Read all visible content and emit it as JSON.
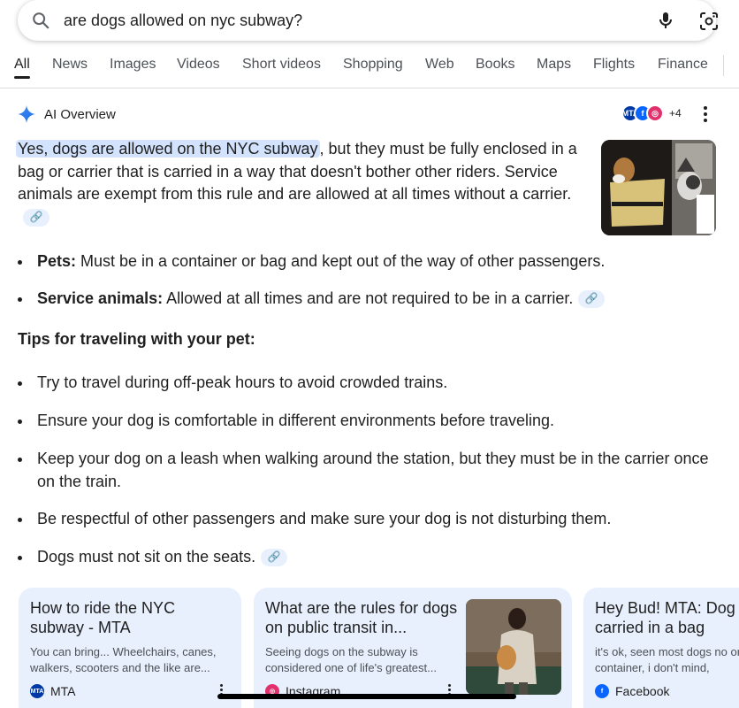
{
  "search": {
    "query": "are dogs allowed on nyc subway?"
  },
  "tabs": [
    "All",
    "News",
    "Images",
    "Videos",
    "Short videos",
    "Shopping",
    "Web",
    "Books",
    "Maps",
    "Flights",
    "Finance"
  ],
  "ai_overview": {
    "title": "AI Overview",
    "sources_more": "+4",
    "answer_highlight": "Yes, dogs are allowed on the NYC subway",
    "answer_rest": ", but they must be fully enclosed in a bag or carrier that is carried in a way that doesn't bother other riders. Service animals are exempt from this rule and are allowed at all times without a carrier.",
    "bullets": [
      {
        "label": "Pets:",
        "text": " Must be in a container or bag and kept out of the way of other passengers."
      },
      {
        "label": "Service animals:",
        "text": " Allowed at all times and are not required to be in a carrier."
      }
    ],
    "tips_title": "Tips for traveling with your pet:",
    "tips": [
      "Try to travel during off-peak hours to avoid crowded trains.",
      "Ensure your dog is comfortable in different environments before traveling.",
      "Keep your dog on a leash when walking around the station, but they must be in the carrier once on the train.",
      "Be respectful of other passengers and make sure your dog is not disturbing them.",
      "Dogs must not sit on the seats."
    ]
  },
  "cards": [
    {
      "title": "How to ride the NYC subway - MTA",
      "snippet": "You can bring... Wheelchairs, canes, walkers, scooters and the like are...",
      "source": "MTA"
    },
    {
      "title": "What are the rules for dogs on public transit in...",
      "snippet": "Seeing dogs on the subway is considered one of life's greatest...",
      "source": "Instagram"
    },
    {
      "title": "Hey Bud! MTA: Dog be carried in a bag",
      "snippet": "it's ok, seen most dogs no or container, i don't mind,",
      "source": "Facebook"
    }
  ],
  "colors": {
    "chip": "#e8f0fe",
    "highlight": "#d3e3fd",
    "mta": "#0039a6",
    "facebook": "#0866ff",
    "instagram": "#e1306c"
  },
  "icons": [
    "search-icon",
    "mic-icon",
    "lens-icon",
    "sparkle-icon",
    "link-icon",
    "more-vert-icon"
  ]
}
